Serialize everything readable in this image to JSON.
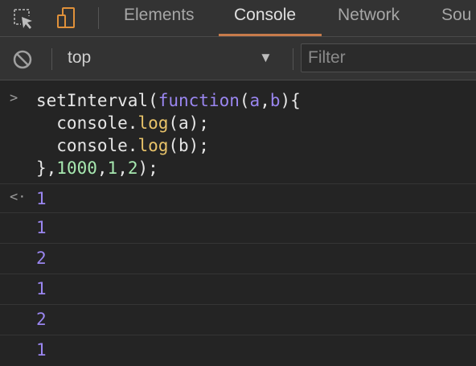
{
  "tabs": {
    "items": [
      {
        "label": "Elements"
      },
      {
        "label": "Console"
      },
      {
        "label": "Network"
      },
      {
        "label": "Sou"
      }
    ],
    "active": "Console"
  },
  "toolbar": {
    "context": "top",
    "filter_placeholder": "Filter"
  },
  "console": {
    "input": {
      "line1_a": "setInterval(",
      "line1_kw": "function",
      "line1_b": "(",
      "line1_p1": "a",
      "line1_c": ",",
      "line1_p2": "b",
      "line1_d": "){",
      "line2_a": "  console.",
      "line2_fn": "log",
      "line2_b": "(a);",
      "line3_a": "  console.",
      "line3_fn": "log",
      "line3_b": "(b);",
      "line4_a": "},",
      "line4_n1": "1000",
      "line4_b": ",",
      "line4_n2": "1",
      "line4_c": ",",
      "line4_n3": "2",
      "line4_d": ");"
    },
    "result": "1",
    "logs": [
      "1",
      "2",
      "1",
      "2",
      "1"
    ]
  },
  "colors": {
    "accent": "#c77b4b",
    "keyword": "#9a86f0",
    "function": "#e8c36a",
    "number": "#a7e8b0"
  },
  "icons": [
    "inspect-element-icon",
    "device-toolbar-icon",
    "clear-console-icon",
    "dropdown-caret-icon",
    "input-prompt-icon",
    "result-return-icon"
  ]
}
